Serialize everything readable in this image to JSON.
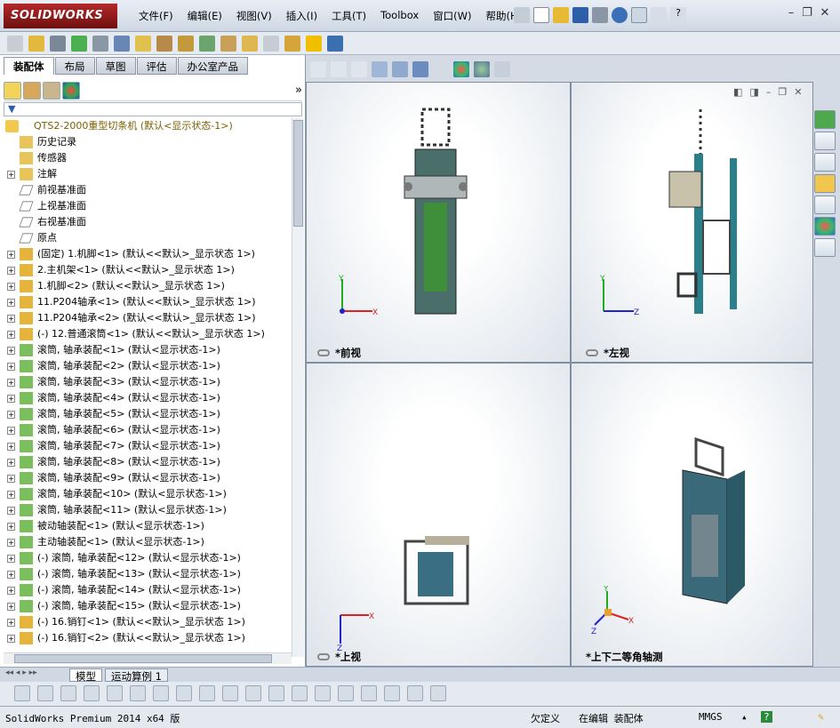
{
  "app": {
    "logo": "SOLIDWORKS"
  },
  "menu": [
    "文件(F)",
    "编辑(E)",
    "视图(V)",
    "插入(I)",
    "工具(T)",
    "Toolbox",
    "窗口(W)",
    "帮助(H)"
  ],
  "tabs": [
    "装配体",
    "布局",
    "草图",
    "评估",
    "办公室产品"
  ],
  "tree": {
    "root": "QTS2-2000重型切条机  (默认<显示状态-1>)",
    "items": [
      "历史记录",
      "传感器",
      "注解",
      "前视基准面",
      "上视基准面",
      "右视基准面",
      "原点",
      "(固定) 1.机脚<1> (默认<<默认>_显示状态 1>)",
      "2.主机架<1> (默认<<默认>_显示状态 1>)",
      "1.机脚<2> (默认<<默认>_显示状态 1>)",
      "11.P204轴承<1> (默认<<默认>_显示状态 1>)",
      "11.P204轴承<2> (默认<<默认>_显示状态 1>)",
      "(-) 12.普通滚筒<1> (默认<<默认>_显示状态 1>)",
      "滚筒, 轴承装配<1> (默认<显示状态-1>)",
      "滚筒, 轴承装配<2> (默认<显示状态-1>)",
      "滚筒, 轴承装配<3> (默认<显示状态-1>)",
      "滚筒, 轴承装配<4> (默认<显示状态-1>)",
      "滚筒, 轴承装配<5> (默认<显示状态-1>)",
      "滚筒, 轴承装配<6> (默认<显示状态-1>)",
      "滚筒, 轴承装配<7> (默认<显示状态-1>)",
      "滚筒, 轴承装配<8> (默认<显示状态-1>)",
      "滚筒, 轴承装配<9> (默认<显示状态-1>)",
      "滚筒, 轴承装配<10> (默认<显示状态-1>)",
      "滚筒, 轴承装配<11> (默认<显示状态-1>)",
      "被动轴装配<1> (默认<显示状态-1>)",
      "主动轴装配<1> (默认<显示状态-1>)",
      "(-) 滚筒, 轴承装配<12> (默认<显示状态-1>)",
      "(-) 滚筒, 轴承装配<13> (默认<显示状态-1>)",
      "(-) 滚筒, 轴承装配<14> (默认<显示状态-1>)",
      "(-) 滚筒, 轴承装配<15> (默认<显示状态-1>)",
      "(-) 16.销钉<1> (默认<<默认>_显示状态 1>)",
      "(-) 16.销钉<2> (默认<<默认>_显示状态 1>)"
    ]
  },
  "views": {
    "front": "*前视",
    "left": "*左视",
    "top": "*上视",
    "iso": "*上下二等角轴测"
  },
  "bottom_tabs": [
    "模型",
    "运动算例 1"
  ],
  "status": {
    "app": "SolidWorks Premium 2014 x64 版",
    "undefined": "欠定义",
    "editing": "在编辑 装配体",
    "units": "MMGS",
    "help": "?"
  },
  "colors": {
    "accent": "#2c5f8a",
    "model_green": "#2e7d32",
    "model_teal": "#2b7f8a"
  }
}
